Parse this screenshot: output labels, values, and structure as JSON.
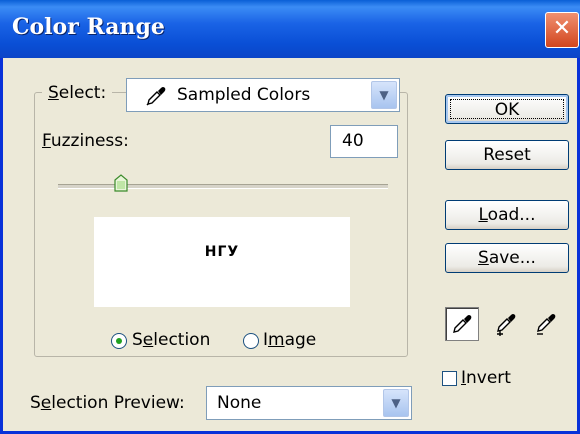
{
  "window": {
    "title": "Color Range",
    "close_icon": "close-icon"
  },
  "select": {
    "label_accel": "S",
    "label_rest": "elect:",
    "value": "Sampled Colors",
    "icon": "eyedropper-icon"
  },
  "fuzziness": {
    "label_accel": "F",
    "label_rest": "uzziness:",
    "value": "40",
    "slider_fraction": 0.19
  },
  "preview_text": "НГУ",
  "view": {
    "selection": {
      "pre": "S",
      "accel": "e",
      "rest": "lection",
      "checked": true
    },
    "image": {
      "pre": "I",
      "accel": "m",
      "rest": "age",
      "checked": false
    }
  },
  "selection_preview": {
    "pre": "S",
    "accel": "e",
    "rest": "lection Preview:",
    "value": "None"
  },
  "buttons": {
    "ok": "OK",
    "reset": "Reset",
    "load": {
      "accel": "L",
      "rest": "oad..."
    },
    "save": {
      "accel": "S",
      "rest": "ave..."
    }
  },
  "tools": [
    "eyedropper-icon",
    "eyedropper-plus-icon",
    "eyedropper-minus-icon"
  ],
  "invert": {
    "accel": "I",
    "rest": "nvert",
    "checked": false
  },
  "colors": {
    "titlebar": "#0a4fd6",
    "dialog_bg": "#ece9d8",
    "close": "#d2461e"
  }
}
